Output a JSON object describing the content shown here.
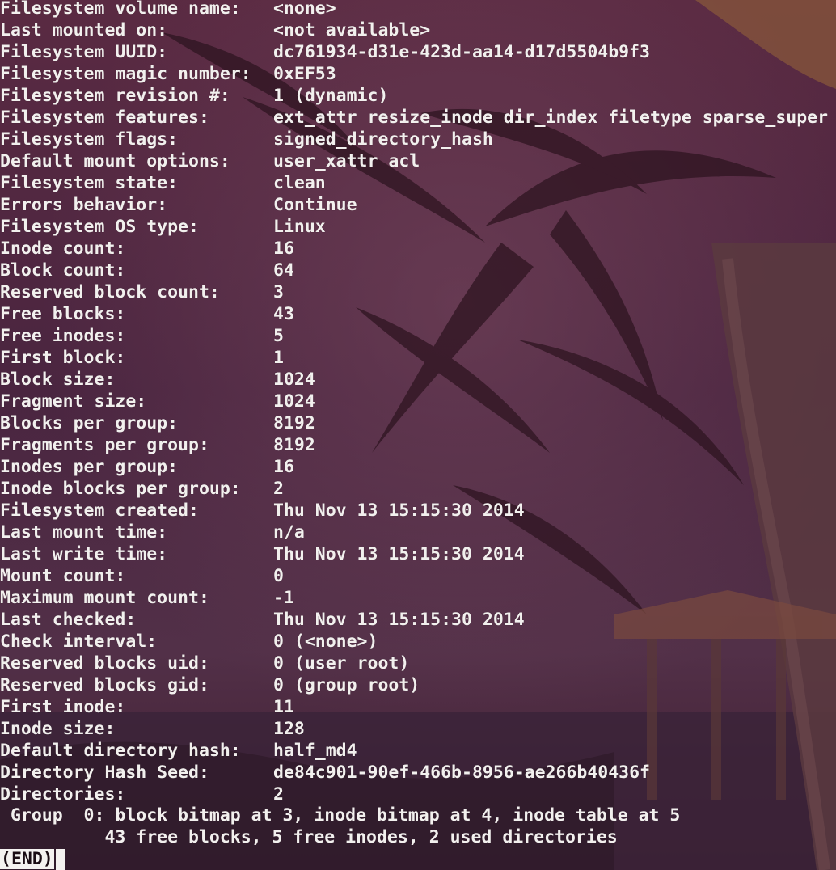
{
  "theme": {
    "text_color": "#f2f0ee",
    "background_tint": "#4a2038"
  },
  "fields": [
    {
      "key": "Filesystem volume name:",
      "value": "<none>"
    },
    {
      "key": "Last mounted on:",
      "value": "<not available>"
    },
    {
      "key": "Filesystem UUID:",
      "value": "dc761934-d31e-423d-aa14-d17d5504b9f3"
    },
    {
      "key": "Filesystem magic number:",
      "value": "0xEF53"
    },
    {
      "key": "Filesystem revision #:",
      "value": "1 (dynamic)"
    },
    {
      "key": "Filesystem features:",
      "value": "ext_attr resize_inode dir_index filetype sparse_super"
    },
    {
      "key": "Filesystem flags:",
      "value": "signed_directory_hash"
    },
    {
      "key": "Default mount options:",
      "value": "user_xattr acl"
    },
    {
      "key": "Filesystem state:",
      "value": "clean"
    },
    {
      "key": "Errors behavior:",
      "value": "Continue"
    },
    {
      "key": "Filesystem OS type:",
      "value": "Linux"
    },
    {
      "key": "Inode count:",
      "value": "16"
    },
    {
      "key": "Block count:",
      "value": "64"
    },
    {
      "key": "Reserved block count:",
      "value": "3"
    },
    {
      "key": "Free blocks:",
      "value": "43"
    },
    {
      "key": "Free inodes:",
      "value": "5"
    },
    {
      "key": "First block:",
      "value": "1"
    },
    {
      "key": "Block size:",
      "value": "1024"
    },
    {
      "key": "Fragment size:",
      "value": "1024"
    },
    {
      "key": "Blocks per group:",
      "value": "8192"
    },
    {
      "key": "Fragments per group:",
      "value": "8192"
    },
    {
      "key": "Inodes per group:",
      "value": "16"
    },
    {
      "key": "Inode blocks per group:",
      "value": "2"
    },
    {
      "key": "Filesystem created:",
      "value": "Thu Nov 13 15:15:30 2014"
    },
    {
      "key": "Last mount time:",
      "value": "n/a"
    },
    {
      "key": "Last write time:",
      "value": "Thu Nov 13 15:15:30 2014"
    },
    {
      "key": "Mount count:",
      "value": "0"
    },
    {
      "key": "Maximum mount count:",
      "value": "-1"
    },
    {
      "key": "Last checked:",
      "value": "Thu Nov 13 15:15:30 2014"
    },
    {
      "key": "Check interval:",
      "value": "0 (<none>)"
    },
    {
      "key": "Reserved blocks uid:",
      "value": "0 (user root)"
    },
    {
      "key": "Reserved blocks gid:",
      "value": "0 (group root)"
    },
    {
      "key": "First inode:",
      "value": "11"
    },
    {
      "key": "Inode size:",
      "value": "128"
    },
    {
      "key": "Default directory hash:",
      "value": "half_md4"
    },
    {
      "key": "Directory Hash Seed:",
      "value": "de84c901-90ef-466b-8956-ae266b40436f"
    },
    {
      "key": "Directories:",
      "value": "2"
    }
  ],
  "group": {
    "line1": " Group  0: block bitmap at 3, inode bitmap at 4, inode table at 5",
    "line2": "          43 free blocks, 5 free inodes, 2 used directories"
  },
  "pager": {
    "end_label": "(END)"
  }
}
